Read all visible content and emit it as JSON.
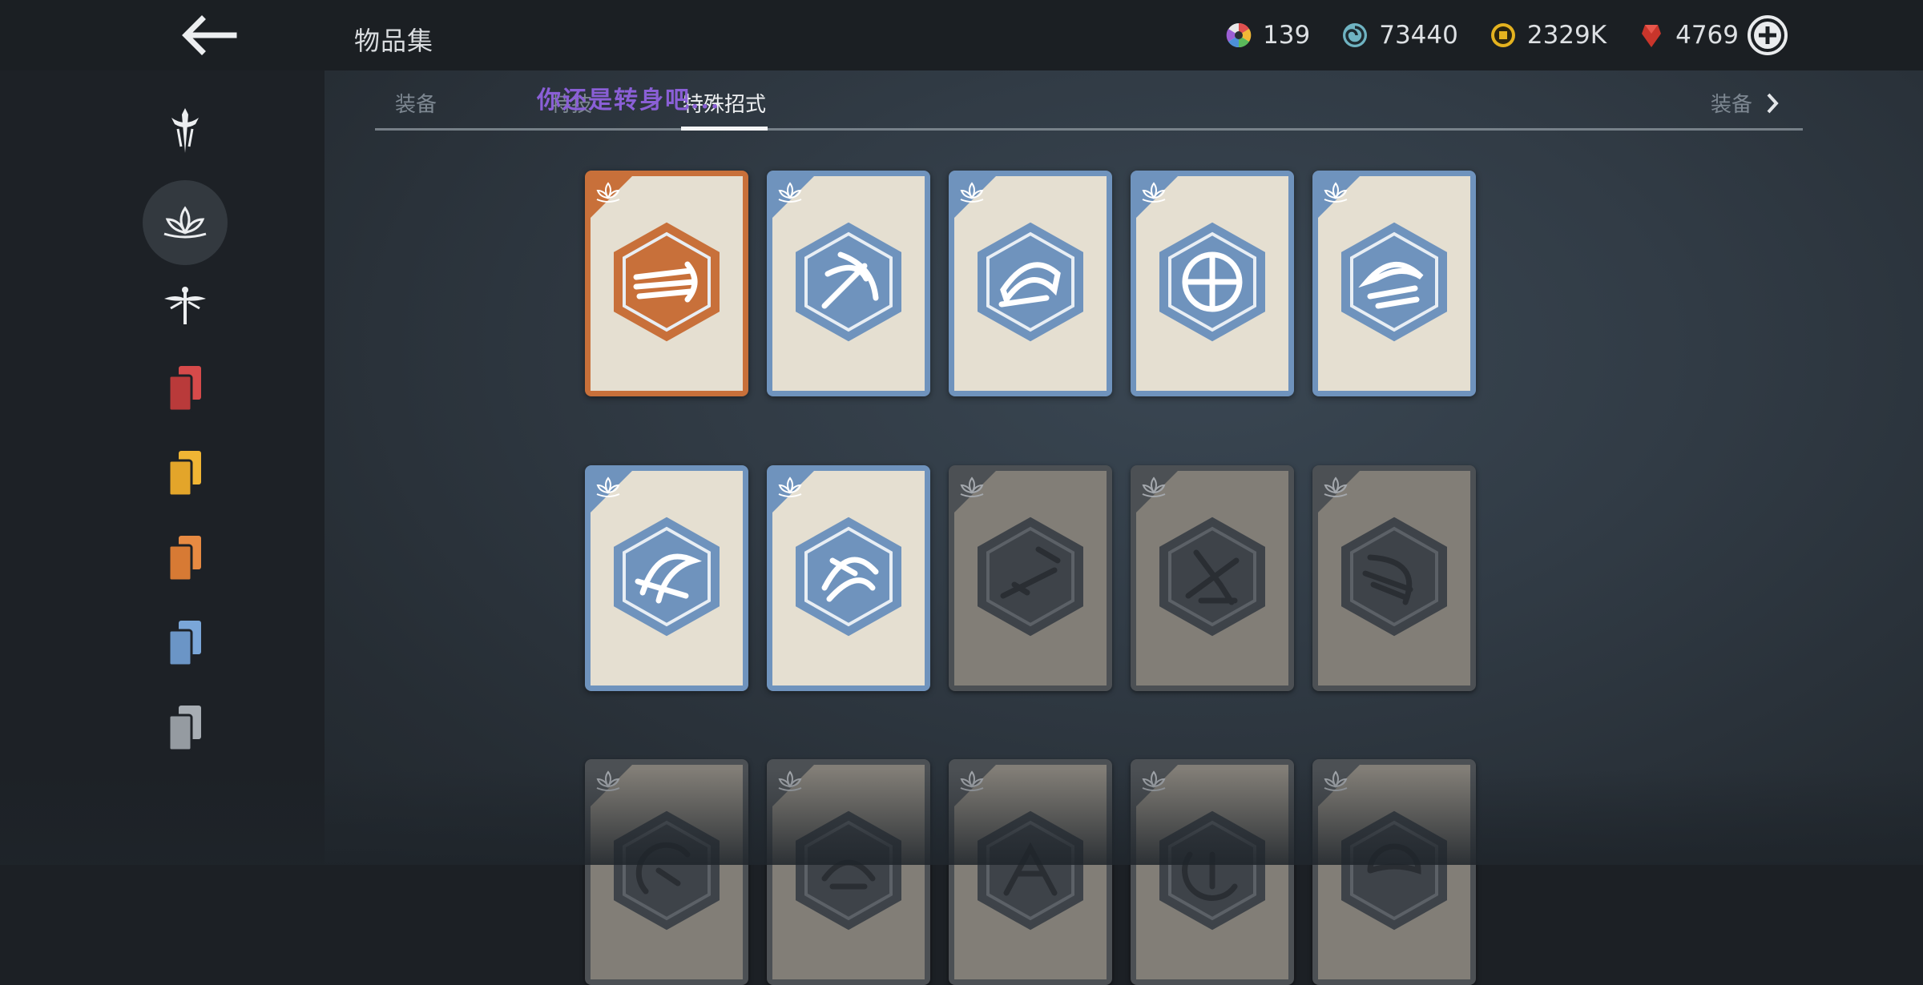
{
  "header": {
    "title": "物品集",
    "back_icon": "arrow-left-icon",
    "add_icon": "plus-circle-icon"
  },
  "currencies": [
    {
      "name": "color-orb-icon",
      "value": "139"
    },
    {
      "name": "spiral-icon",
      "value": "73440"
    },
    {
      "name": "coin-icon",
      "value": "2329K"
    },
    {
      "name": "red-gem-icon",
      "value": "4769"
    }
  ],
  "sidebar": {
    "items": [
      {
        "icon": "sword-emblem-icon",
        "active": false
      },
      {
        "icon": "lotus-icon",
        "active": true
      },
      {
        "icon": "dragonfly-icon",
        "active": false
      },
      {
        "icon": "red-cards-icon",
        "color": "#d64a4a"
      },
      {
        "icon": "yellow-cards-icon",
        "color": "#f0b534"
      },
      {
        "icon": "orange-cards-icon",
        "color": "#e78a42"
      },
      {
        "icon": "blue-cards-icon",
        "color": "#7aa6d8"
      },
      {
        "icon": "gray-cards-icon",
        "color": "#a7adb3"
      }
    ]
  },
  "tabs": {
    "items": [
      "装备",
      "特技",
      "特殊招式"
    ],
    "active_index": 2,
    "next_label": "装备",
    "overlay_text": "你还是转身吧..."
  },
  "colors": {
    "orange": "#c8703a",
    "blue": "#6f93bd",
    "locked": "#4c5054",
    "paper": "#e5dfd1",
    "paper_locked": "#827e77"
  },
  "cards": [
    {
      "rarity": "orange",
      "icon": "triple-blade-icon"
    },
    {
      "rarity": "blue",
      "icon": "curved-slash-icon"
    },
    {
      "rarity": "blue",
      "icon": "fan-blade-icon"
    },
    {
      "rarity": "blue",
      "icon": "circle-bow-icon"
    },
    {
      "rarity": "blue",
      "icon": "crescent-sword-icon"
    },
    {
      "rarity": "blue",
      "icon": "sweep-slash-icon"
    },
    {
      "rarity": "blue",
      "icon": "spin-slash-icon"
    },
    {
      "rarity": "locked",
      "icon": "thrust-slash-icon"
    },
    {
      "rarity": "locked",
      "icon": "dagger-strike-icon"
    },
    {
      "rarity": "locked",
      "icon": "arc-blade-icon"
    },
    {
      "rarity": "locked",
      "icon": "skill-icon"
    },
    {
      "rarity": "locked",
      "icon": "skill-icon"
    },
    {
      "rarity": "locked",
      "icon": "skill-icon"
    },
    {
      "rarity": "locked",
      "icon": "skill-icon"
    },
    {
      "rarity": "locked",
      "icon": "skill-icon"
    }
  ]
}
